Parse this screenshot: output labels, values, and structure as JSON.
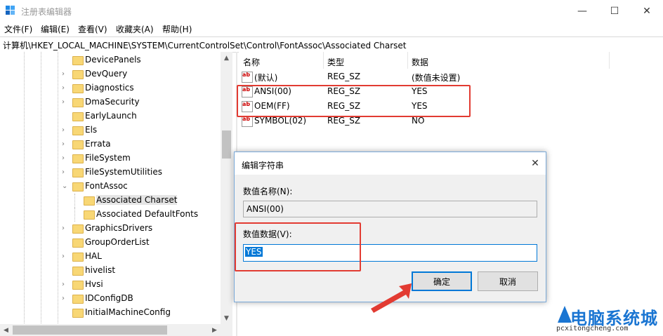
{
  "window": {
    "title": "注册表编辑器",
    "icon": "registry-icon",
    "minimize_glyph": "—",
    "maximize_glyph": "☐",
    "close_glyph": "✕"
  },
  "menu": [
    "文件(F)",
    "编辑(E)",
    "查看(V)",
    "收藏夹(A)",
    "帮助(H)"
  ],
  "address": "计算机\\HKEY_LOCAL_MACHINE\\SYSTEM\\CurrentControlSet\\Control\\FontAssoc\\Associated Charset",
  "tree": {
    "items": [
      {
        "label": "DevicePanels",
        "expandable": false
      },
      {
        "label": "DevQuery",
        "expandable": true
      },
      {
        "label": "Diagnostics",
        "expandable": true
      },
      {
        "label": "DmaSecurity",
        "expandable": true
      },
      {
        "label": "EarlyLaunch",
        "expandable": false
      },
      {
        "label": "Els",
        "expandable": true
      },
      {
        "label": "Errata",
        "expandable": true
      },
      {
        "label": "FileSystem",
        "expandable": true
      },
      {
        "label": "FileSystemUtilities",
        "expandable": true
      },
      {
        "label": "FontAssoc",
        "expandable": true,
        "expanded": true
      },
      {
        "label": "Associated Charset",
        "child": true,
        "selected": true
      },
      {
        "label": "Associated DefaultFonts",
        "child": true
      },
      {
        "label": "GraphicsDrivers",
        "expandable": true
      },
      {
        "label": "GroupOrderList",
        "expandable": false
      },
      {
        "label": "HAL",
        "expandable": true
      },
      {
        "label": "hivelist",
        "expandable": false
      },
      {
        "label": "Hvsi",
        "expandable": true
      },
      {
        "label": "IDConfigDB",
        "expandable": true
      },
      {
        "label": "InitialMachineConfig",
        "expandable": false
      }
    ]
  },
  "list": {
    "columns": [
      "名称",
      "类型",
      "数据"
    ],
    "rows": [
      {
        "name": "(默认)",
        "type": "REG_SZ",
        "data": "(数值未设置)"
      },
      {
        "name": "ANSI(00)",
        "type": "REG_SZ",
        "data": "YES"
      },
      {
        "name": "OEM(FF)",
        "type": "REG_SZ",
        "data": "YES"
      },
      {
        "name": "SYMBOL(02)",
        "type": "REG_SZ",
        "data": "NO"
      }
    ],
    "value_icon_text": "ab"
  },
  "dialog": {
    "title": "编辑字符串",
    "name_label": "数值名称(N):",
    "name_value": "ANSI(00)",
    "data_label": "数值数据(V):",
    "data_value": "YES",
    "ok_label": "确定",
    "cancel_label": "取消"
  },
  "watermark": {
    "text": "电脑系统城",
    "url": "pcxitongcheng.com"
  },
  "colors": {
    "highlight": "#e23b32",
    "accent": "#0078d7",
    "folder": "#f8d775"
  }
}
